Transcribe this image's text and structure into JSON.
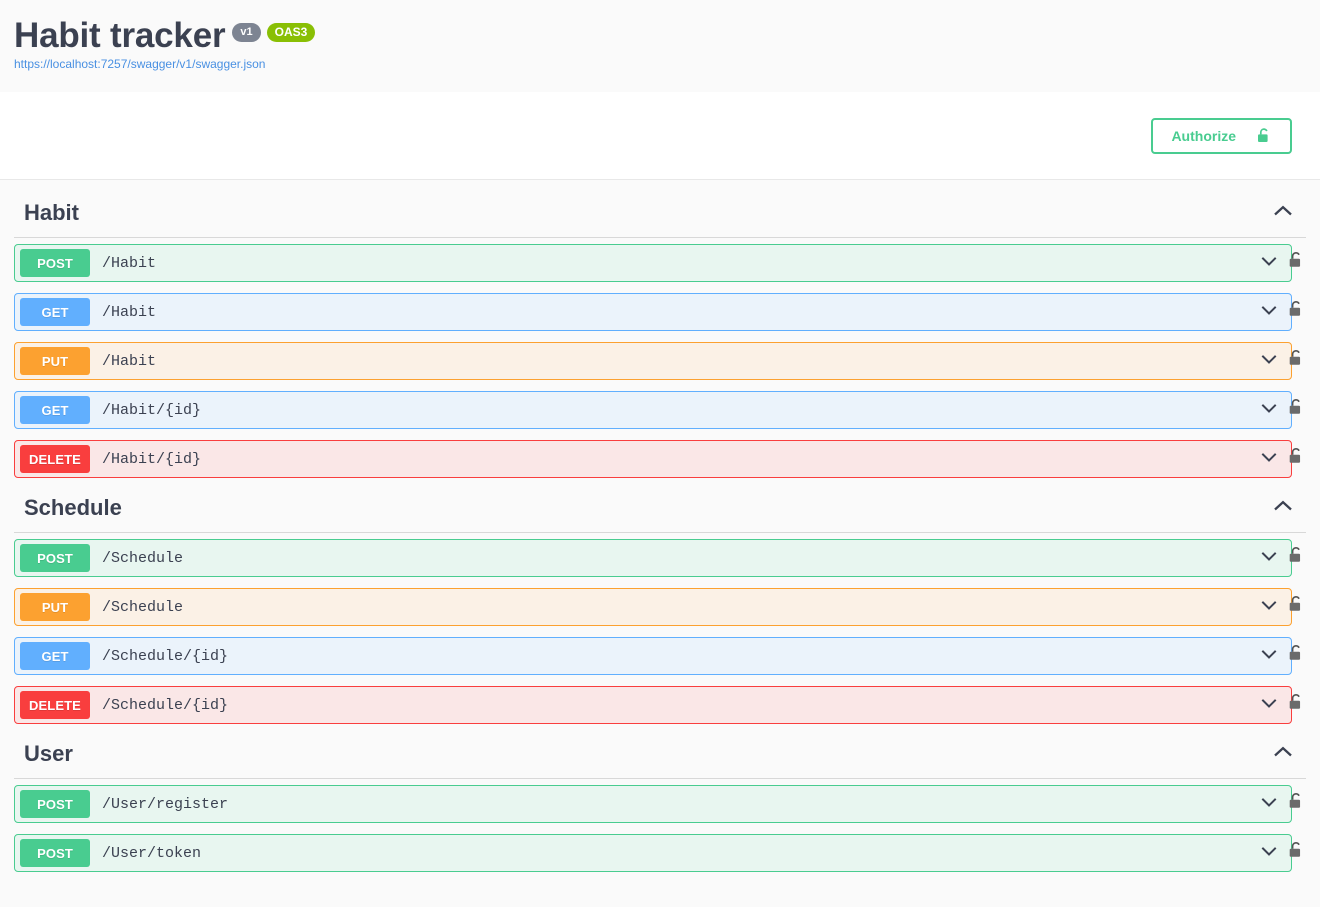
{
  "header": {
    "title": "Habit tracker",
    "version_badge": "v1",
    "oas_badge": "OAS3",
    "spec_url": "https://localhost:7257/swagger/v1/swagger.json"
  },
  "scheme_bar": {
    "authorize_label": "Authorize",
    "lock_icon": "unlock-icon"
  },
  "colors": {
    "post": "#49cc90",
    "get": "#61affe",
    "put": "#fca130",
    "delete": "#f93e3e",
    "version_badge": "#7d8492",
    "oas_badge": "#89bf04",
    "link": "#4990e2",
    "text": "#3b4151"
  },
  "sections": [
    {
      "title": "Habit",
      "collapse_icon": "chevron-up-icon",
      "operations": [
        {
          "method": "POST",
          "path": "/Habit",
          "style": "post",
          "expand_icon": "chevron-down-icon",
          "lock_icon": "lock-icon"
        },
        {
          "method": "GET",
          "path": "/Habit",
          "style": "get",
          "expand_icon": "chevron-down-icon",
          "lock_icon": "lock-icon"
        },
        {
          "method": "PUT",
          "path": "/Habit",
          "style": "put",
          "expand_icon": "chevron-down-icon",
          "lock_icon": "lock-icon"
        },
        {
          "method": "GET",
          "path": "/Habit/{id}",
          "style": "get",
          "expand_icon": "chevron-down-icon",
          "lock_icon": "lock-icon"
        },
        {
          "method": "DELETE",
          "path": "/Habit/{id}",
          "style": "del",
          "expand_icon": "chevron-down-icon",
          "lock_icon": "lock-icon"
        }
      ]
    },
    {
      "title": "Schedule",
      "collapse_icon": "chevron-up-icon",
      "operations": [
        {
          "method": "POST",
          "path": "/Schedule",
          "style": "post",
          "expand_icon": "chevron-down-icon",
          "lock_icon": "lock-icon"
        },
        {
          "method": "PUT",
          "path": "/Schedule",
          "style": "put",
          "expand_icon": "chevron-down-icon",
          "lock_icon": "lock-icon"
        },
        {
          "method": "GET",
          "path": "/Schedule/{id}",
          "style": "get",
          "expand_icon": "chevron-down-icon",
          "lock_icon": "lock-icon"
        },
        {
          "method": "DELETE",
          "path": "/Schedule/{id}",
          "style": "del",
          "expand_icon": "chevron-down-icon",
          "lock_icon": "lock-icon"
        }
      ]
    },
    {
      "title": "User",
      "collapse_icon": "chevron-up-icon",
      "operations": [
        {
          "method": "POST",
          "path": "/User/register",
          "style": "post",
          "expand_icon": "chevron-down-icon",
          "lock_icon": "lock-icon"
        },
        {
          "method": "POST",
          "path": "/User/token",
          "style": "post",
          "expand_icon": "chevron-down-icon",
          "lock_icon": "lock-icon"
        }
      ]
    }
  ]
}
